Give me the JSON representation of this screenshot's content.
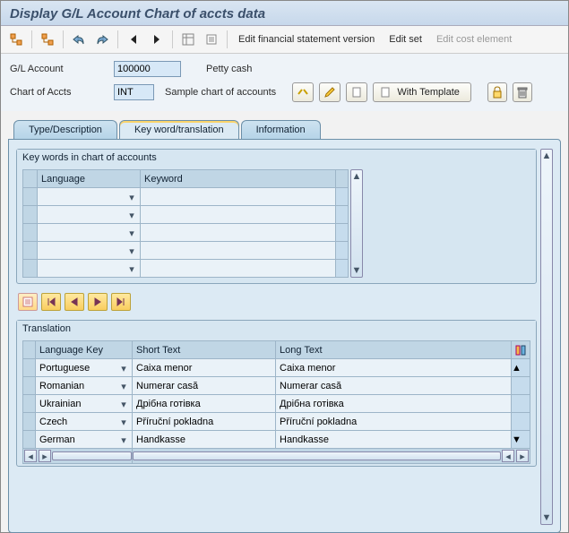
{
  "title": "Display G/L Account Chart of accts data",
  "toolbar_links": {
    "edit_fsv": "Edit financial statement version",
    "edit_set": "Edit set",
    "edit_cost": "Edit cost element"
  },
  "form": {
    "gl_label": "G/L Account",
    "gl_value": "100000",
    "gl_desc": "Petty cash",
    "coa_label": "Chart of Accts",
    "coa_value": "INT",
    "coa_desc": "Sample chart of accounts",
    "with_template": "With Template"
  },
  "tabs": {
    "t1": "Type/Description",
    "t2": "Key word/translation",
    "t3": "Information"
  },
  "panel1": {
    "title": "Key words in chart of accounts",
    "col_lang": "Language",
    "col_keyword": "Keyword"
  },
  "panel2": {
    "title": "Translation",
    "col_langkey": "Language Key",
    "col_short": "Short Text",
    "col_long": "Long Text",
    "rows": [
      {
        "lang": "Portuguese",
        "short": "Caixa menor",
        "long": "Caixa menor"
      },
      {
        "lang": "Romanian",
        "short": "Numerar casă",
        "long": "Numerar casă"
      },
      {
        "lang": "Ukrainian",
        "short": "Дрібна готівка",
        "long": "Дрібна готівка"
      },
      {
        "lang": "Czech",
        "short": "Příruční pokladna",
        "long": "Příruční pokladna"
      },
      {
        "lang": "German",
        "short": "Handkasse",
        "long": "Handkasse"
      }
    ]
  }
}
